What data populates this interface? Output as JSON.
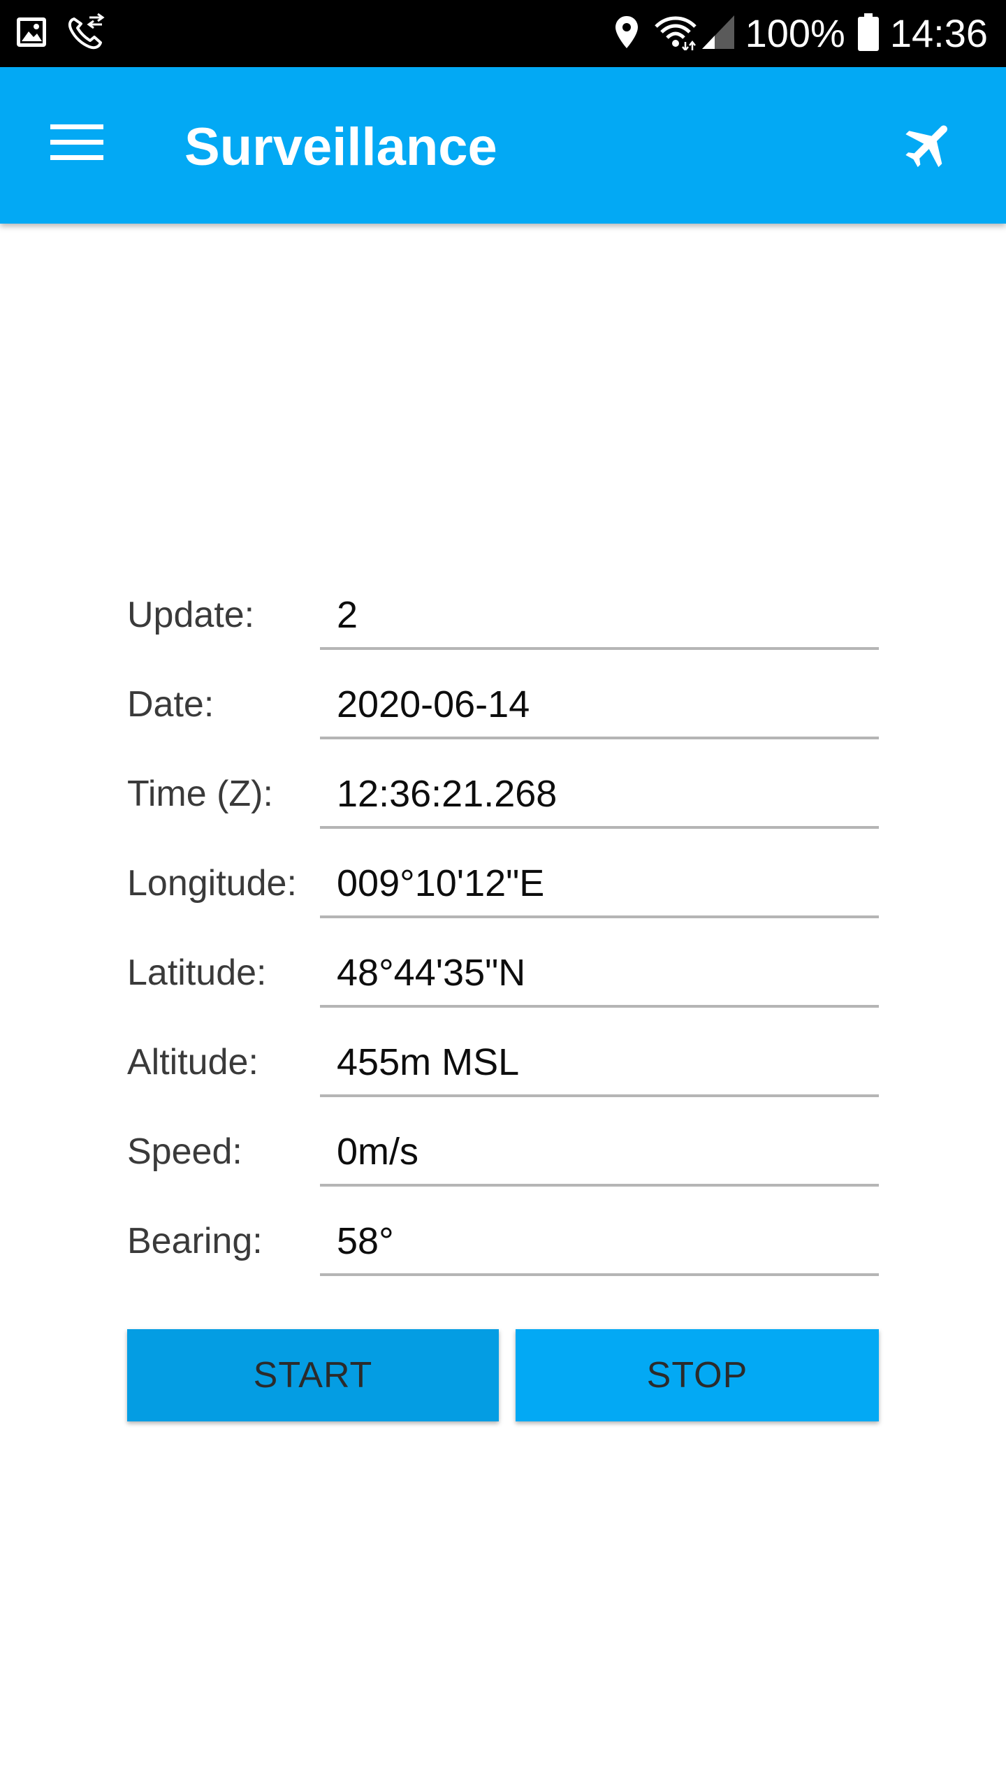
{
  "status_bar": {
    "battery_percent": "100%",
    "time": "14:36",
    "icons": [
      "gallery-icon",
      "phone-call-icon",
      "location-pin-icon",
      "wifi-icon",
      "cell-signal-icon",
      "battery-icon"
    ]
  },
  "app_bar": {
    "title": "Surveillance",
    "menu_icon": "hamburger-menu-icon",
    "action_icon": "airplane-icon",
    "color": "#03a9f4"
  },
  "fields": [
    {
      "label": "Update:",
      "value": "2"
    },
    {
      "label": "Date:",
      "value": "2020-06-14"
    },
    {
      "label": "Time (Z):",
      "value": "12:36:21.268"
    },
    {
      "label": "Longitude:",
      "value": "009°10'12\"E"
    },
    {
      "label": "Latitude:",
      "value": "48°44'35\"N"
    },
    {
      "label": "Altitude:",
      "value": "455m MSL"
    },
    {
      "label": "Speed:",
      "value": "0m/s"
    },
    {
      "label": "Bearing:",
      "value": "58°"
    }
  ],
  "buttons": {
    "start_label": "START",
    "stop_label": "STOP"
  }
}
